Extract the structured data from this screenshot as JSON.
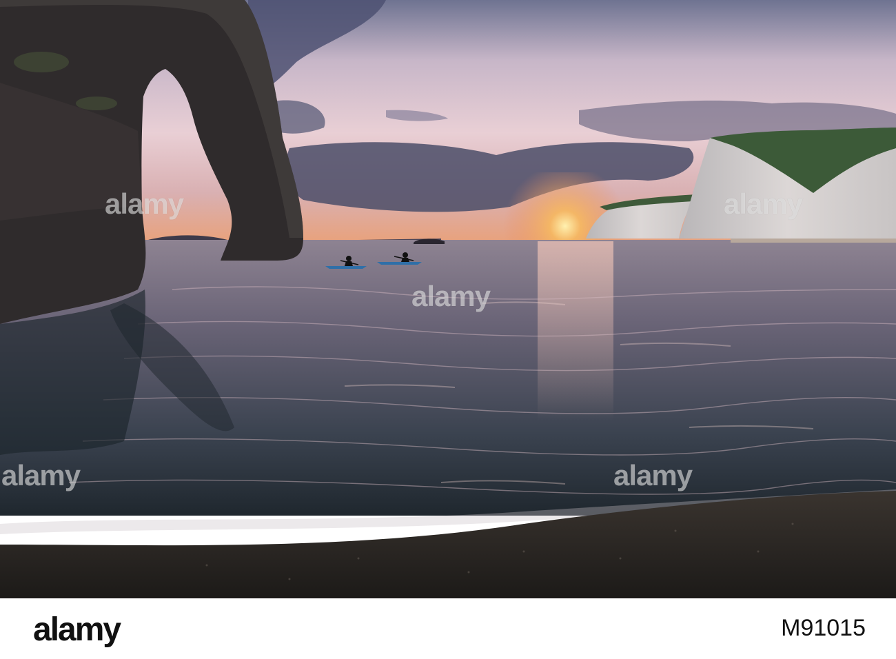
{
  "watermark": {
    "text": "alamy"
  },
  "footer": {
    "logo": "alamy",
    "image_id": "M91015"
  }
}
